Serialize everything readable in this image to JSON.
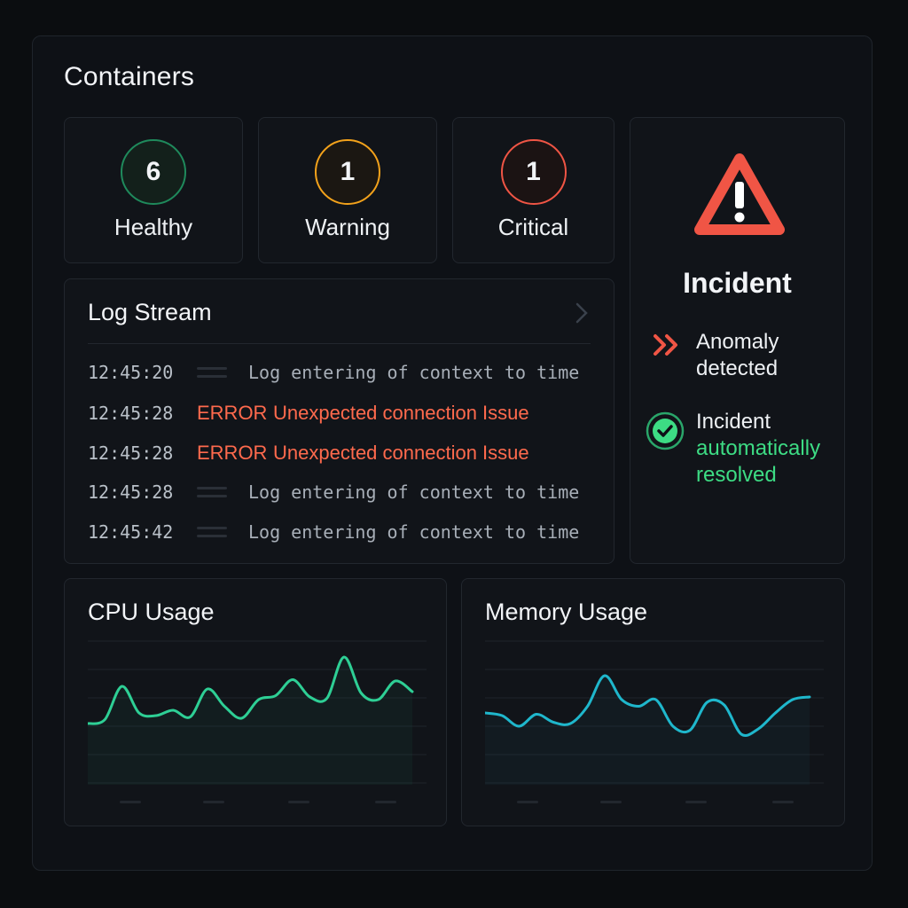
{
  "title": "Containers",
  "stats": [
    {
      "value": "6",
      "label": "Healthy",
      "color": "#1f8a5c"
    },
    {
      "value": "1",
      "label": "Warning",
      "color": "#f3a21b"
    },
    {
      "value": "1",
      "label": "Critical",
      "color": "#f05545"
    }
  ],
  "log": {
    "title": "Log Stream",
    "rows": [
      {
        "time": "12:45:20",
        "level": "",
        "message": "Log entering of context to time"
      },
      {
        "time": "12:45:28",
        "level": "ERROR",
        "message": "Unexpected connection Issue"
      },
      {
        "time": "12:45:28",
        "level": "ERROR",
        "message": "Unexpected connection Issue"
      },
      {
        "time": "12:45:28",
        "level": "",
        "message": "Log entering of context to time"
      },
      {
        "time": "12:45:42",
        "level": "",
        "message": "Log entering of context to time"
      }
    ]
  },
  "incident": {
    "title": "Incident",
    "anomaly_line1": "Anomaly",
    "anomaly_line2": "detected",
    "resolved_line1": "Incident",
    "resolved_line2": "automatically",
    "resolved_line3": "resolved",
    "alert_color": "#f05545",
    "ok_color": "#3ddc84"
  },
  "cpu": {
    "title": "CPU Usage",
    "color": "#2ecf95",
    "values": [
      42,
      45,
      70,
      50,
      48,
      52,
      47,
      68,
      55,
      46,
      60,
      63,
      75,
      62,
      61,
      92,
      65,
      60,
      74,
      66
    ]
  },
  "memory": {
    "title": "Memory Usage",
    "color": "#1fb7cc",
    "values": [
      50,
      48,
      40,
      49,
      43,
      42,
      55,
      78,
      60,
      55,
      60,
      40,
      37,
      58,
      56,
      34,
      38,
      50,
      60,
      62
    ]
  }
}
